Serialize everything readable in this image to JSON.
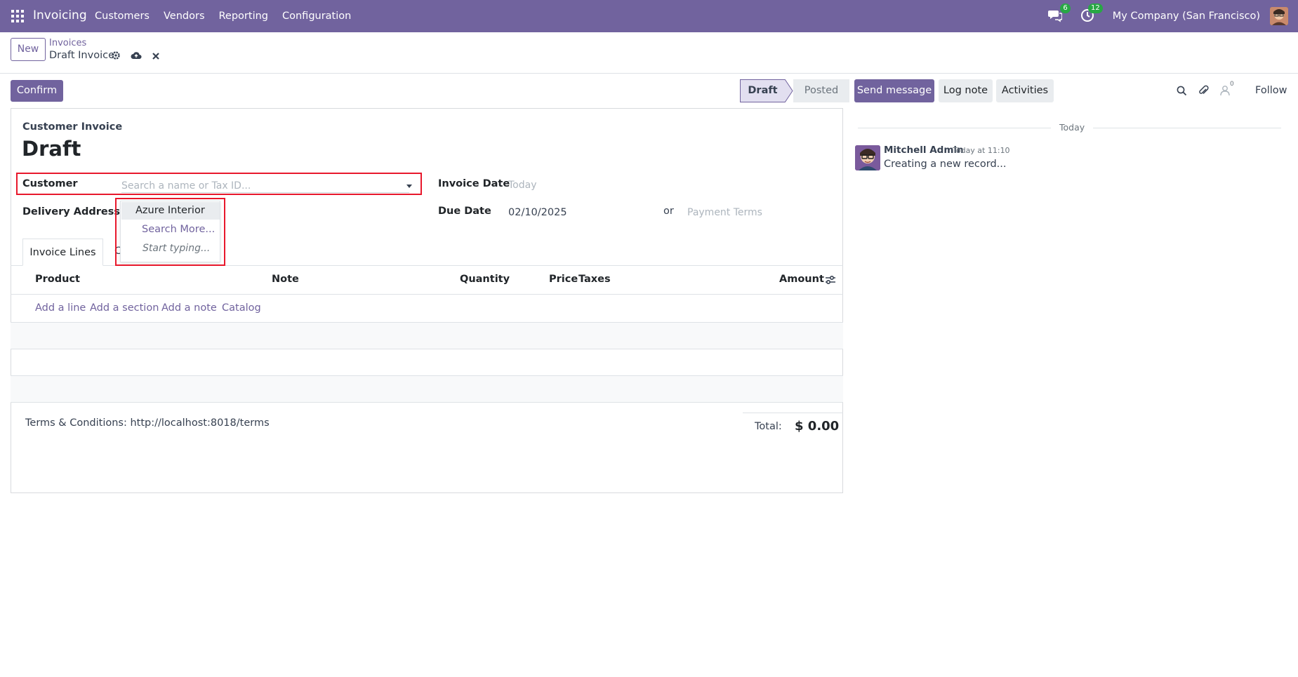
{
  "navbar": {
    "app_name": "Invoicing",
    "menu": [
      "Customers",
      "Vendors",
      "Reporting",
      "Configuration"
    ],
    "messages_count": "6",
    "activities_count": "12",
    "company": "My Company (San Francisco)"
  },
  "control": {
    "new_label": "New",
    "breadcrumb_parent": "Invoices",
    "breadcrumb_current": "Draft Invoice"
  },
  "actions": {
    "confirm_label": "Confirm",
    "status_draft": "Draft",
    "status_posted": "Posted"
  },
  "form": {
    "subtitle": "Customer Invoice",
    "title": "Draft",
    "customer_label": "Customer",
    "customer_placeholder": "Search a name or Tax ID...",
    "delivery_label": "Delivery Address",
    "delivery_help": "?",
    "invoice_date_label": "Invoice Date",
    "invoice_date_placeholder": "Today",
    "due_date_label": "Due Date",
    "due_date_value": "02/10/2025",
    "or_label": "or",
    "payment_terms_placeholder": "Payment Terms",
    "dropdown": {
      "item1": "Azure Interior",
      "item2": "Search More...",
      "item3": "Start typing..."
    },
    "tab_invoice_lines": "Invoice Lines",
    "table_headers": {
      "product": "Product",
      "note": "Note",
      "quantity": "Quantity",
      "price": "Price",
      "taxes": "Taxes",
      "amount": "Amount"
    },
    "links": {
      "add_line": "Add a line",
      "add_section": "Add a section",
      "add_note": "Add a note",
      "catalog": "Catalog"
    },
    "terms": "Terms & Conditions: http://localhost:8018/terms",
    "total_label": "Total:",
    "total_value": "$ 0.00"
  },
  "chatter": {
    "send_message": "Send message",
    "log_note": "Log note",
    "activities": "Activities",
    "followers_count": "0",
    "follow": "Follow",
    "today": "Today",
    "author": "Mitchell Admin",
    "time": "Today at 11:10",
    "message": "Creating a new record..."
  },
  "colors": {
    "brand": "#71639e",
    "highlight": "#e8182c",
    "badge": "#28a745"
  }
}
